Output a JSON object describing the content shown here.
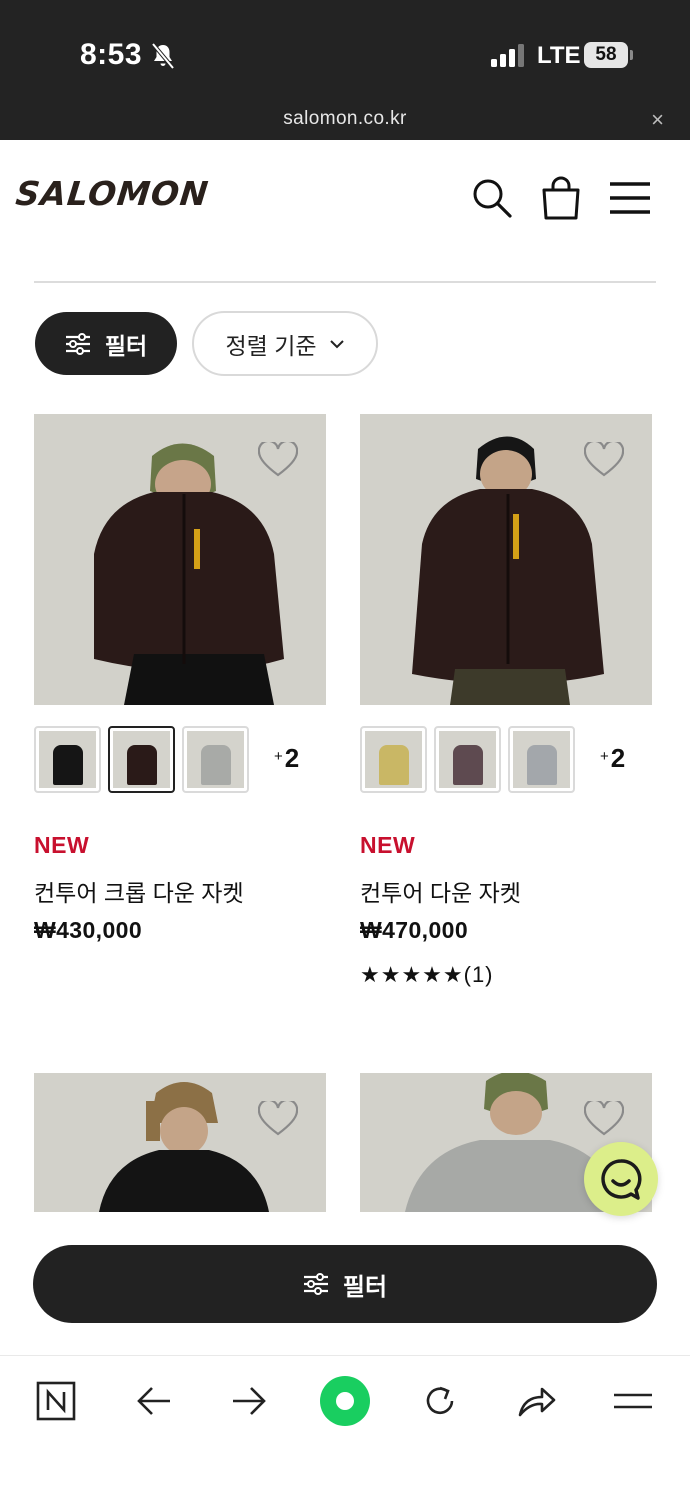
{
  "status": {
    "time": "8:53",
    "network": "LTE",
    "battery": "58"
  },
  "browser": {
    "url": "salomon.co.kr",
    "close_symbol": "×"
  },
  "header": {
    "brand": "SALOMON",
    "icons": [
      "search-icon",
      "bag-icon",
      "menu-icon"
    ]
  },
  "toolbar": {
    "filter_label": "필터",
    "sort_label": "정렬 기준"
  },
  "products": [
    {
      "badge": "NEW",
      "name": "컨투어 크롭 다운 자켓",
      "price": "₩430,000",
      "more_colors": "2",
      "rating_text": ""
    },
    {
      "badge": "NEW",
      "name": "컨투어 다운 자켓",
      "price": "₩470,000",
      "more_colors": "2",
      "rating_stars": "★★★★★",
      "rating_count": "(1)"
    }
  ],
  "bottom_filter": {
    "label": "필터"
  },
  "nav": {
    "items": [
      "naver-n-icon",
      "back-arrow-icon",
      "forward-arrow-icon",
      "home-dot-icon",
      "reload-icon",
      "share-icon",
      "menu-icon"
    ],
    "home_color": "#19ce60"
  },
  "colors": {
    "accent_new": "#c8102e",
    "chat_fab": "#dcee8a"
  }
}
